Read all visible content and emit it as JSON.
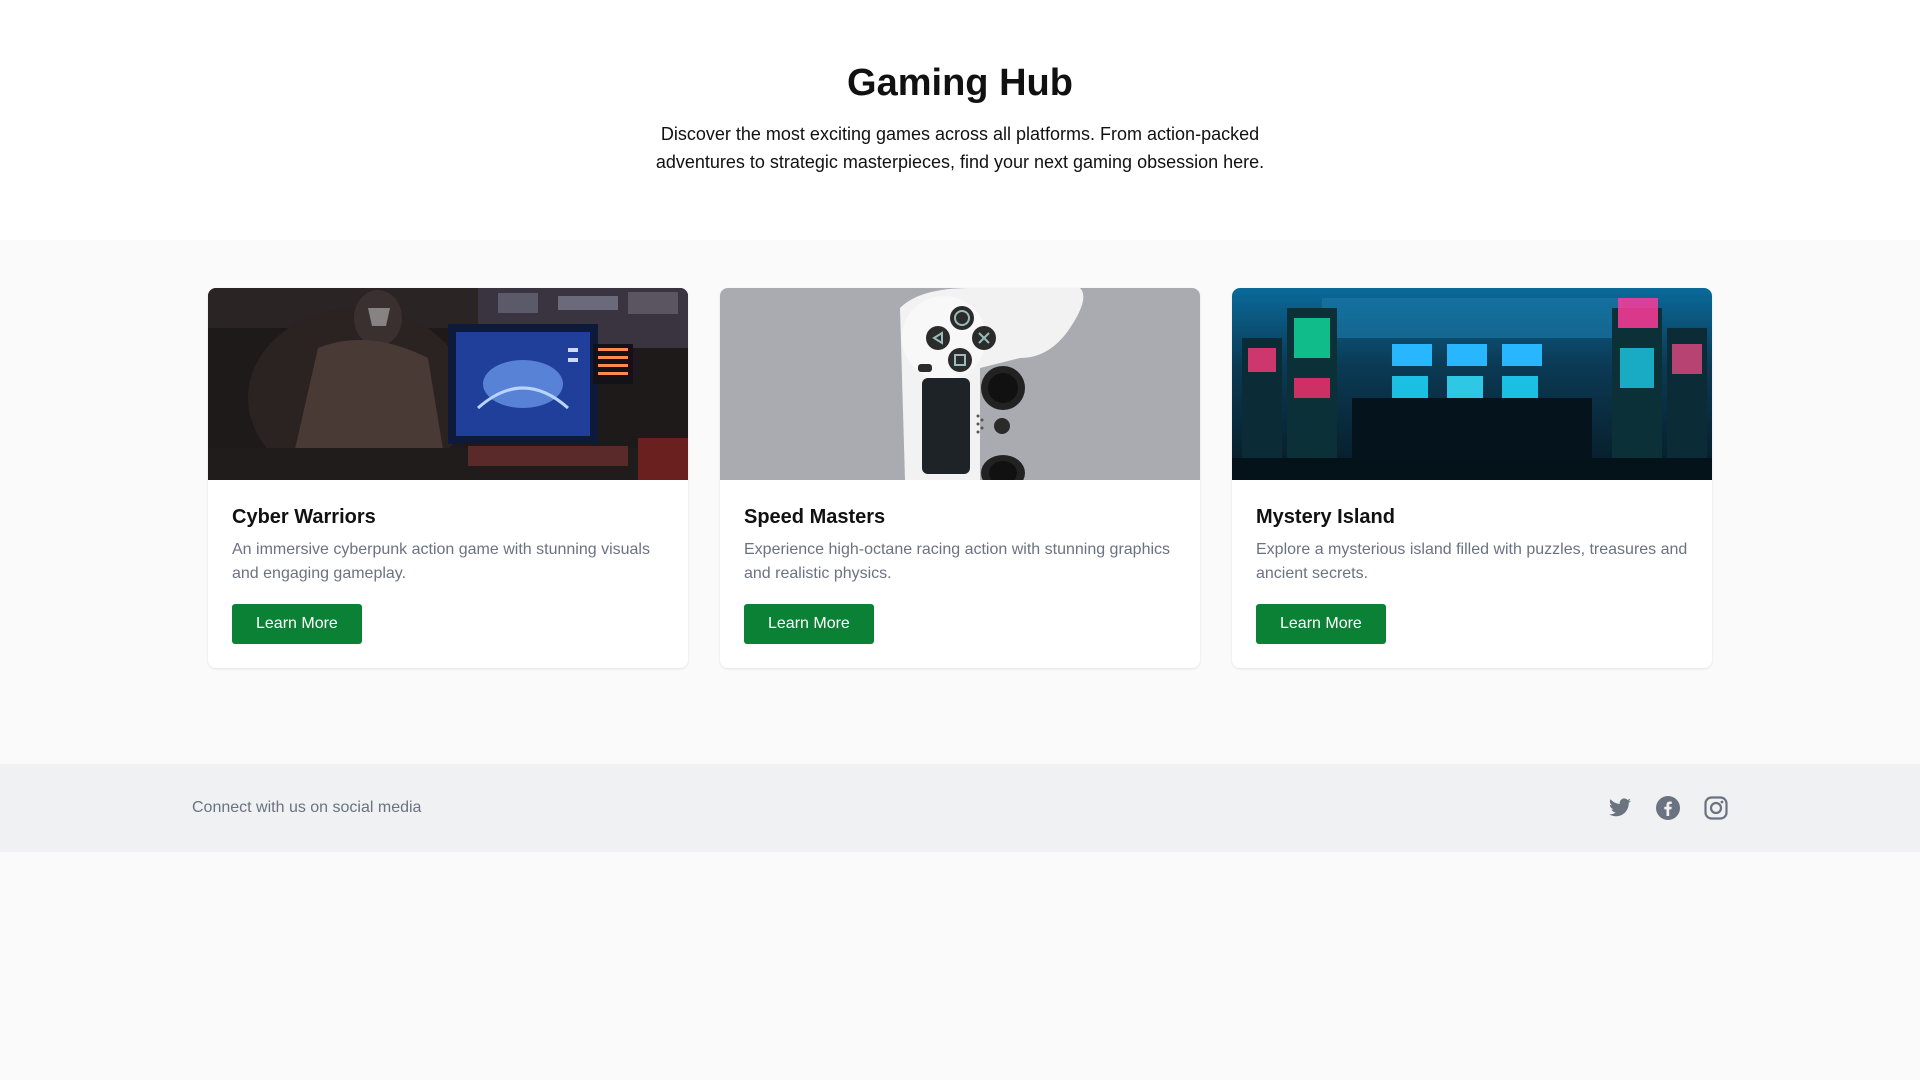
{
  "hero": {
    "title": "Gaming Hub",
    "description": "Discover the most exciting games across all platforms. From action-packed adventures to strategic masterpieces, find your next gaming obsession here."
  },
  "cards": [
    {
      "title": "Cyber Warriors",
      "description": "An immersive cyberpunk action game with stunning visuals and engaging gameplay.",
      "button_label": "Learn More",
      "image": "esports-player-photo"
    },
    {
      "title": "Speed Masters",
      "description": "Experience high-octane racing action with stunning graphics and realistic physics.",
      "button_label": "Learn More",
      "image": "white-game-controller-photo"
    },
    {
      "title": "Mystery Island",
      "description": "Explore a mysterious island filled with puzzles, treasures and ancient secrets.",
      "button_label": "Learn More",
      "image": "neon-arcade-photo"
    }
  ],
  "footer": {
    "text": "Connect with us on social media",
    "social": [
      "twitter-icon",
      "facebook-icon",
      "instagram-icon"
    ]
  },
  "colors": {
    "accent": "#0b8136",
    "muted_text": "#6b7280",
    "footer_bg": "#f0f1f3",
    "page_bg": "#fafafa"
  }
}
